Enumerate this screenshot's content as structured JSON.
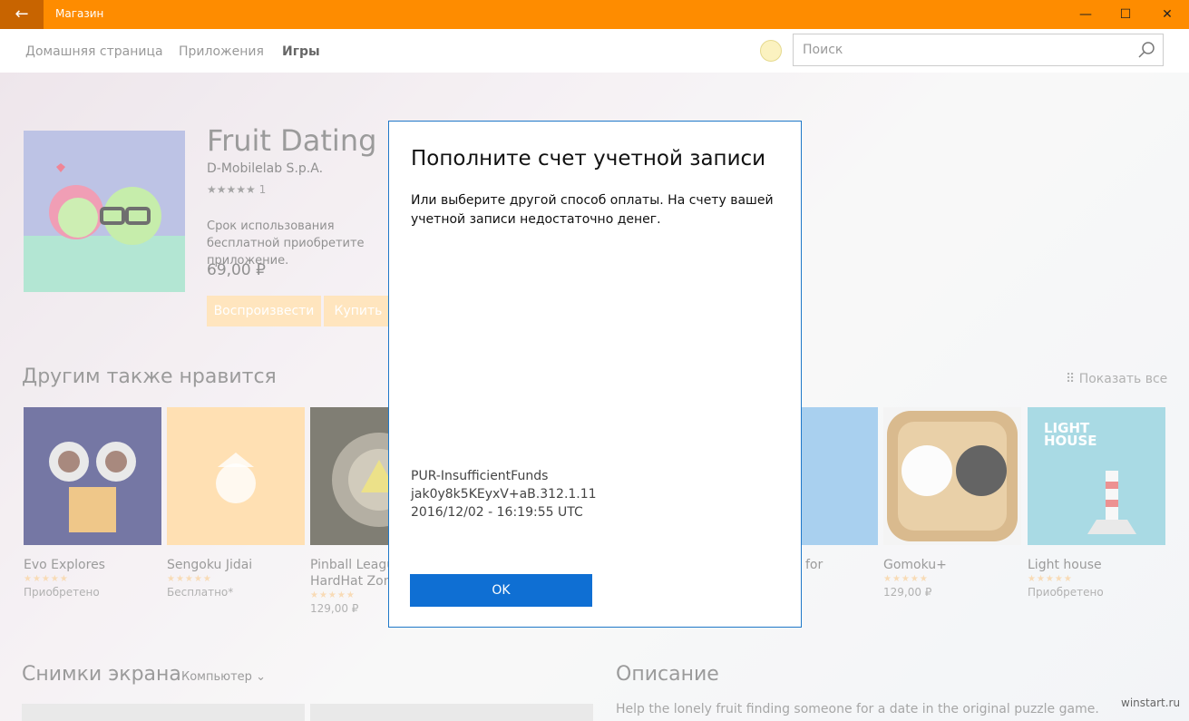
{
  "window": {
    "title": "Магазин",
    "back_icon": "←",
    "minimize_icon": "—",
    "maximize_icon": "☐",
    "close_icon": "✕",
    "accent_color": "#fe8c00"
  },
  "nav": {
    "tabs": [
      "Домашняя страница",
      "Приложения",
      "Игры"
    ],
    "active_tab": "Игры",
    "search_placeholder": "Поиск"
  },
  "product": {
    "title": "Fruit Dating",
    "publisher": "D-Mobilelab S.p.A.",
    "rating_stars": "★★★★★",
    "rating_count": "1",
    "trial_text": "Срок использования бесплатной приобретите приложение.",
    "price": "69,00 ₽",
    "play_label": "Воспроизвести",
    "buy_label": "Купить"
  },
  "related": {
    "heading": "Другим также нравится",
    "show_all": "Показать все",
    "items": [
      {
        "name": "Evo Explores",
        "stars": "★★★★★",
        "status": "Приобретено",
        "color": "#2b2f74"
      },
      {
        "name": "Sengoku Jidai",
        "stars": "★★★★★",
        "status": "Бесплатно*",
        "color": "#ffcf8a"
      },
      {
        "name": "Pinball League",
        "name2": "HardHat Zone",
        "stars": "★★★★★",
        "status": "129,00 ₽",
        "color": "#3d3a2a"
      },
      {
        "name": "for",
        "stars": "",
        "status": "",
        "color": "#7bb7e6"
      },
      {
        "name": "Gomoku+",
        "stars": "★★★★★",
        "status": "129,00 ₽",
        "color": "#c59552"
      },
      {
        "name": "Light house",
        "stars": "★★★★★",
        "status": "Приобретено",
        "color": "#7cc6d6",
        "logo": "LIGHT HOUSE"
      }
    ]
  },
  "screenshots": {
    "heading": "Снимки экрана",
    "filter": "Компьютер"
  },
  "description": {
    "heading": "Описание",
    "text": "Help the lonely fruit finding someone for a date in the original puzzle game."
  },
  "dialog": {
    "title": "Пополните счет учетной записи",
    "body": "Или выберите другой способ оплаты. На счету вашей учетной записи недостаточно денег.",
    "error_code": "PUR-InsufficientFunds",
    "correlation_id": "jak0y8k5KEyxV+aB.312.1.11",
    "timestamp": "2016/12/02 - 16:19:55 UTC",
    "ok_label": "OK",
    "button_color": "#0f6fd3"
  },
  "watermark": "winstart.ru"
}
